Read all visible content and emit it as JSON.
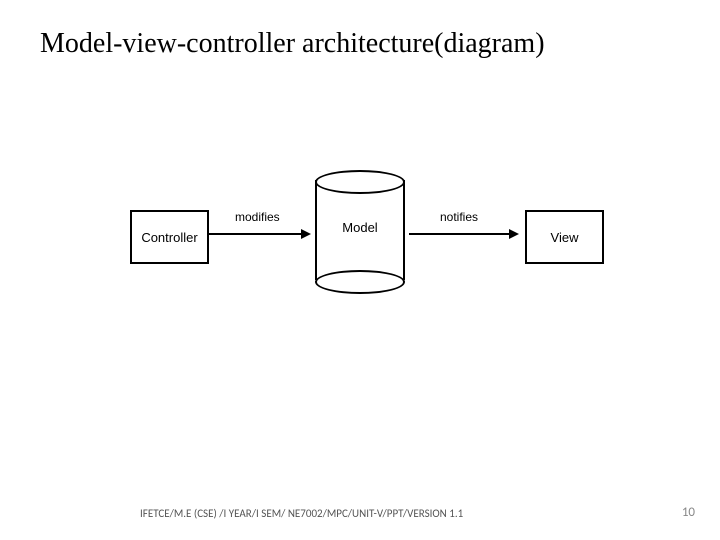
{
  "title": "Model-view-controller architecture(diagram)",
  "diagram": {
    "controller": "Controller",
    "model": "Model",
    "view": "View",
    "edge_modifies": "modifies",
    "edge_notifies": "notifies"
  },
  "footer": "IFETCE/M.E (CSE) /I YEAR/I SEM/ NE7002/MPC/UNIT-V/PPT/VERSION 1.1",
  "page_number": "10"
}
